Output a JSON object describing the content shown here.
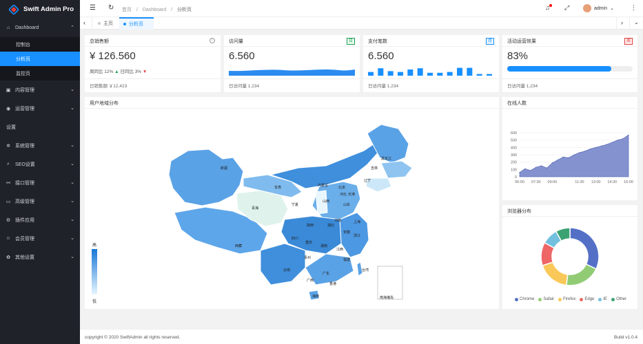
{
  "app": {
    "title": "Swift Admin Pro"
  },
  "sidebar": {
    "dashboard": {
      "label": "Dashboard",
      "children": [
        "控制台",
        "分析页",
        "监控页"
      ]
    },
    "items": [
      "内容管理",
      "运营管理"
    ],
    "group_label": "设置",
    "items2": [
      "系统管理",
      "SEO设置",
      "接口管理",
      "高级管理",
      "插件应用",
      "会员管理",
      "其他设置"
    ]
  },
  "header": {
    "breadcrumb": [
      "首页",
      "Dashboard",
      "分析页"
    ],
    "user": "admin"
  },
  "tabs": {
    "items": [
      "主页",
      "分析页"
    ]
  },
  "cards": {
    "sales": {
      "title": "总销售额",
      "value": "¥ 126.560",
      "week": "周同比 12%",
      "day": "日同比 3%",
      "footer": "日销售额 ￥12,423"
    },
    "visits": {
      "title": "访问量",
      "badge": "日",
      "value": "6.560",
      "footer": "日访问量 1,234"
    },
    "payments": {
      "title": "支付笔数",
      "badge": "月",
      "value": "6.560",
      "footer": "日访问量 1,234",
      "bars": [
        0.45,
        0.9,
        0.55,
        0.45,
        0.75,
        0.9,
        0.35,
        0.35,
        0.45,
        0.95,
        0.95,
        0.2,
        0.2
      ]
    },
    "ops": {
      "title": "活动运营效果",
      "badge": "周",
      "value": "83%",
      "progress": 0.83,
      "footer": "日访问量 1,234"
    }
  },
  "map": {
    "title": "用户地域分布",
    "legend_high": "高",
    "legend_low": "低",
    "labels": [
      "新疆",
      "西藏",
      "青海",
      "甘肃",
      "内蒙古",
      "黑龙江",
      "吉林",
      "辽宁",
      "山西",
      "山东",
      "河南",
      "四川",
      "重庆",
      "湖北",
      "湖南",
      "云南",
      "贵州",
      "广西",
      "广东",
      "福建",
      "江西",
      "浙江",
      "上海",
      "安徽",
      "陕西",
      "宁夏",
      "河北",
      "北京",
      "天津",
      "海南",
      "台湾",
      "香港",
      "南海诸岛"
    ]
  },
  "online": {
    "title": "在线人数",
    "chart_data": {
      "type": "area",
      "x": [
        "06:00",
        "06:30",
        "07:00",
        "07:30",
        "08:00",
        "08:30",
        "09:00",
        "09:30",
        "10:00",
        "10:30",
        "11:00",
        "11:30",
        "12:00",
        "12:30",
        "13:00",
        "13:30",
        "14:00",
        "14:30",
        "15:00",
        "15:30",
        "16:00"
      ],
      "values": [
        60,
        110,
        85,
        130,
        150,
        120,
        190,
        230,
        270,
        260,
        300,
        330,
        350,
        380,
        400,
        420,
        440,
        470,
        500,
        520,
        570
      ],
      "xticks": [
        "06:00",
        "07:30",
        "09:00",
        "11:30",
        "13:00",
        "14:30",
        "16:00"
      ],
      "yticks": [
        0,
        100,
        200,
        300,
        400,
        500,
        600
      ],
      "ylim": [
        0,
        600
      ],
      "color": "#6e80c7"
    }
  },
  "browser": {
    "title": "浏览器分布",
    "chart_data": {
      "type": "pie",
      "labels": [
        "Chrome",
        "Safair",
        "Firefox",
        "Edge",
        "IE",
        "Other"
      ],
      "values": [
        32,
        20,
        18,
        13,
        9,
        8
      ],
      "colors": [
        "#5470c6",
        "#91cc75",
        "#fac858",
        "#ee6666",
        "#73c0de",
        "#3ba272"
      ]
    }
  },
  "footer": {
    "copyright": "copyright © 2020 SwiftAdmin all rights reserved.",
    "build": "Build v1.0.4"
  }
}
